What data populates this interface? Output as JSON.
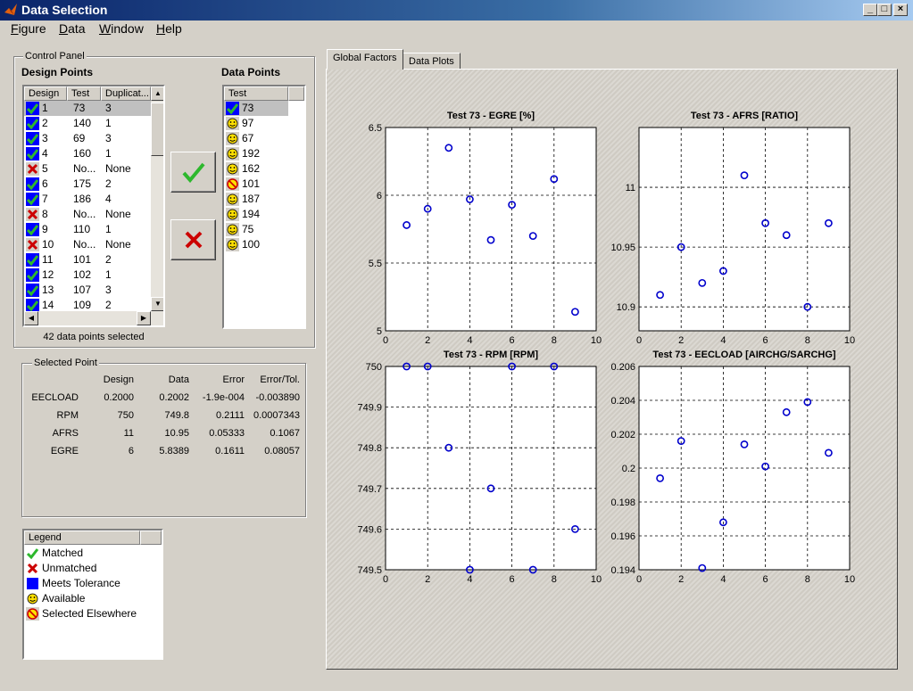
{
  "window": {
    "title": "Data Selection"
  },
  "menu": [
    "Figure",
    "Data",
    "Window",
    "Help"
  ],
  "control_panel": {
    "label": "Control Panel",
    "design_points_label": "Design Points",
    "data_points_label": "Data Points",
    "design_columns": [
      "Design",
      "Test",
      "Duplicat..."
    ],
    "design_rows": [
      {
        "design": "1",
        "test": "73",
        "dup": "3",
        "status": "matched",
        "selected": true
      },
      {
        "design": "2",
        "test": "140",
        "dup": "1",
        "status": "matched"
      },
      {
        "design": "3",
        "test": "69",
        "dup": "3",
        "status": "matched"
      },
      {
        "design": "4",
        "test": "160",
        "dup": "1",
        "status": "matched"
      },
      {
        "design": "5",
        "test": "No...",
        "dup": "None",
        "status": "unmatched"
      },
      {
        "design": "6",
        "test": "175",
        "dup": "2",
        "status": "matched"
      },
      {
        "design": "7",
        "test": "186",
        "dup": "4",
        "status": "matched"
      },
      {
        "design": "8",
        "test": "No...",
        "dup": "None",
        "status": "unmatched"
      },
      {
        "design": "9",
        "test": "110",
        "dup": "1",
        "status": "matched"
      },
      {
        "design": "10",
        "test": "No...",
        "dup": "None",
        "status": "unmatched"
      },
      {
        "design": "11",
        "test": "101",
        "dup": "2",
        "status": "matched"
      },
      {
        "design": "12",
        "test": "102",
        "dup": "1",
        "status": "matched"
      },
      {
        "design": "13",
        "test": "107",
        "dup": "3",
        "status": "matched"
      },
      {
        "design": "14",
        "test": "109",
        "dup": "2",
        "status": "matched"
      }
    ],
    "data_column": "Test",
    "data_rows": [
      {
        "test": "73",
        "status": "matched",
        "selected": true
      },
      {
        "test": "97",
        "status": "available"
      },
      {
        "test": "67",
        "status": "available"
      },
      {
        "test": "192",
        "status": "available"
      },
      {
        "test": "162",
        "status": "available"
      },
      {
        "test": "101",
        "status": "elsewhere"
      },
      {
        "test": "187",
        "status": "available"
      },
      {
        "test": "194",
        "status": "available"
      },
      {
        "test": "75",
        "status": "available"
      },
      {
        "test": "100",
        "status": "available"
      }
    ],
    "selected_count": "42 data points selected"
  },
  "selected_point": {
    "label": "Selected Point",
    "columns": [
      "Design",
      "Data",
      "Error",
      "Error/Tol."
    ],
    "rows": [
      {
        "name": "EECLOAD",
        "values": [
          "0.2000",
          "0.2002",
          "-1.9e-004",
          "-0.003890"
        ]
      },
      {
        "name": "RPM",
        "values": [
          "750",
          "749.8",
          "0.2111",
          "0.0007343"
        ]
      },
      {
        "name": "AFRS",
        "values": [
          "11",
          "10.95",
          "0.05333",
          "0.1067"
        ]
      },
      {
        "name": "EGRE",
        "values": [
          "6",
          "5.8389",
          "0.1611",
          "0.08057"
        ]
      }
    ]
  },
  "legend": {
    "label": "Legend",
    "items": [
      {
        "label": "Matched",
        "icon": "check-icon"
      },
      {
        "label": "Unmatched",
        "icon": "cross-icon"
      },
      {
        "label": "Meets Tolerance",
        "icon": "blue-square-icon"
      },
      {
        "label": "Available",
        "icon": "smiley-icon"
      },
      {
        "label": "Selected Elsewhere",
        "icon": "no-smiley-icon"
      }
    ]
  },
  "tabs": [
    "Global Factors",
    "Data Plots"
  ],
  "colors": {
    "marker": "#0000cc",
    "matched": "#2db82d",
    "unmatched": "#cc0000",
    "tolerance": "#0000ff",
    "smiley": "#ffe000"
  },
  "chart_data": [
    {
      "type": "scatter",
      "title": "Test 73 - EGRE [%]",
      "xlim": [
        0,
        10
      ],
      "ylim": [
        5,
        6.5
      ],
      "xticks": [
        "0",
        "2",
        "4",
        "6",
        "8",
        "10"
      ],
      "yticks": [
        "5",
        "5.5",
        "6",
        "6.5"
      ],
      "ytick_values": [
        5,
        5.5,
        6,
        6.5
      ],
      "x": [
        1,
        2,
        3,
        4,
        5,
        6,
        7,
        8,
        9
      ],
      "y": [
        5.78,
        5.9,
        6.35,
        5.97,
        5.67,
        5.93,
        5.7,
        6.12,
        5.14
      ]
    },
    {
      "type": "scatter",
      "title": "Test 73 - AFRS [RATIO]",
      "xlim": [
        0,
        10
      ],
      "ylim": [
        10.88,
        11.05
      ],
      "xticks": [
        "0",
        "2",
        "4",
        "6",
        "8",
        "10"
      ],
      "yticks": [
        "10.9",
        "10.95",
        "11"
      ],
      "ytick_values": [
        10.9,
        10.95,
        11
      ],
      "x": [
        1,
        2,
        3,
        4,
        5,
        6,
        7,
        8,
        9
      ],
      "y": [
        10.91,
        10.95,
        10.92,
        10.93,
        11.01,
        10.97,
        10.96,
        10.9,
        10.97
      ]
    },
    {
      "type": "scatter",
      "title": "Test 73 - RPM [RPM]",
      "xlim": [
        0,
        10
      ],
      "ylim": [
        749.5,
        750
      ],
      "xticks": [
        "0",
        "2",
        "4",
        "6",
        "8",
        "10"
      ],
      "yticks": [
        "749.5",
        "749.6",
        "749.7",
        "749.8",
        "749.9",
        "750"
      ],
      "ytick_values": [
        749.5,
        749.6,
        749.7,
        749.8,
        749.9,
        750
      ],
      "x": [
        1,
        2,
        3,
        4,
        5,
        6,
        7,
        8,
        9
      ],
      "y": [
        750,
        750,
        749.8,
        749.5,
        749.7,
        750,
        749.5,
        750,
        749.6
      ]
    },
    {
      "type": "scatter",
      "title": "Test 73 - EECLOAD [AIRCHG/SARCHG]",
      "xlim": [
        0,
        10
      ],
      "ylim": [
        0.194,
        0.206
      ],
      "xticks": [
        "0",
        "2",
        "4",
        "6",
        "8",
        "10"
      ],
      "yticks": [
        "0.194",
        "0.196",
        "0.198",
        "0.2",
        "0.202",
        "0.204",
        "0.206"
      ],
      "ytick_values": [
        0.194,
        0.196,
        0.198,
        0.2,
        0.202,
        0.204,
        0.206
      ],
      "x": [
        1,
        2,
        3,
        4,
        5,
        6,
        7,
        8,
        9
      ],
      "y": [
        0.1994,
        0.2016,
        0.1941,
        0.1968,
        0.2014,
        0.2001,
        0.2033,
        0.2039,
        0.2009
      ]
    }
  ]
}
